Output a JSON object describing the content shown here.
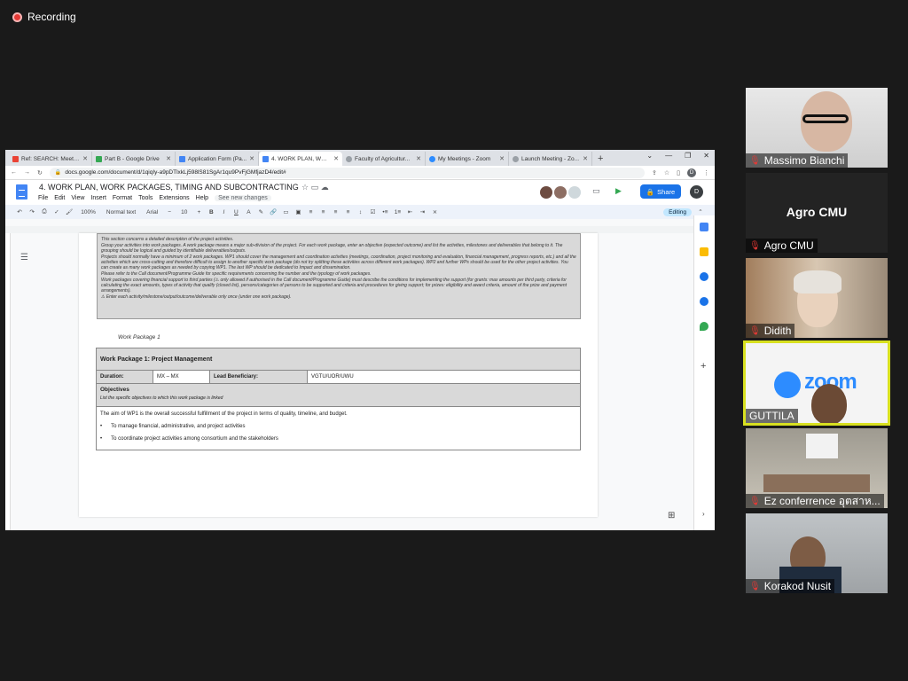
{
  "recording": {
    "label": "Recording"
  },
  "browser": {
    "tabs": [
      {
        "label": "Ref: SEARCH: Meetin...",
        "color": "#ea4335",
        "active": false
      },
      {
        "label": "Part B - Google Drive",
        "color": "#34a853",
        "active": false
      },
      {
        "label": "Application Form (Pa...",
        "color": "#4285f4",
        "active": false
      },
      {
        "label": "4. WORK PLAN, WOR...",
        "color": "#4285f4",
        "active": true
      },
      {
        "label": "Faculty of Agricultur...",
        "color": "#5f6368",
        "active": false
      },
      {
        "label": "My Meetings - Zoom",
        "color": "#2d8cff",
        "active": false
      },
      {
        "label": "Launch Meeting - Zo...",
        "color": "#5f6368",
        "active": false
      }
    ],
    "url": "docs.google.com/document/d/1qiqIy-a9pDTlxkLj598lS81SgAr1qu9PvFjGMfjazD4/edit#",
    "profile_initial": "D"
  },
  "docs": {
    "title": "4. WORK PLAN, WORK PACKAGES, TIMING AND SUBCONTRACTING",
    "menus": [
      "File",
      "Edit",
      "View",
      "Insert",
      "Format",
      "Tools",
      "Extensions",
      "Help"
    ],
    "see_changes": "See new changes",
    "share_label": "Share",
    "user_initial": "D",
    "toolbar": {
      "zoom": "100%",
      "style": "Normal text",
      "font": "Arial",
      "size": "10",
      "mode": "Editing"
    }
  },
  "document": {
    "guide": [
      "This section concerns a detailed description of the project activities.",
      "Group your activities into work packages. A work package means a major sub-division of the project. For each work package, enter an objective (expected outcome) and list the activities, milestones and deliverables that belong to it. The grouping should be logical and guided by identifiable deliverables/outputs.",
      "Projects should normally have a minimum of 2 work packages. WP1 should cover the management and coordination activities (meetings, coordination, project monitoring and evaluation, financial management, progress reports, etc.) and all the activities which are cross-cutting and therefore difficult to assign to another specific work package (do not try splitting these activities across different work packages). WP2 and further WPs should be used for the other project activities. You can create as many work packages as needed by copying WP1. The last WP should be dedicated to Impact and dissemination.",
      "Please refer to the Call document/Programme Guide for specific requirements concerning the number and the typology of work packages.",
      "Work packages covering financial support to third parties (⚠ only allowed if authorised in the Call document/Programme Guide) must describe the conditions for implementing the support (for grants: max amounts per third party, criteria for calculating the exact amounts, types of activity that qualify (closed list), persons/categories of persons to be supported and criteria and procedures for giving support; for prizes: eligibility and award criteria, amount of the prize and payment arrangements).",
      "⚠ Enter each activity/milestone/output/outcome/deliverable only once (under one work package)."
    ],
    "wp_label": "Work Package 1",
    "wp_title": "Work Package 1:  Project Management",
    "duration_label": "Duration:",
    "duration_value": "MX – MX",
    "lead_label": "Lead Beneficiary:",
    "lead_value": "VGTU/UOR/UWU",
    "objectives_title": "Objectives",
    "objectives_hint": "List the specific objectives to which this work package is linked",
    "aim": "The aim of WP1 is the overall successful fulfillment of the project in terms of quality, timeline, and budget.",
    "bullets": [
      "To manage financial, administrative, and project activities",
      "To coordinate project activities among consortium and the stakeholders"
    ]
  },
  "participants": [
    {
      "name": "Massimo Bianchi",
      "muted": true
    },
    {
      "name": "Agro CMU",
      "muted": true,
      "display": "Agro CMU"
    },
    {
      "name": "Didith",
      "muted": true
    },
    {
      "name": "GUTTILA",
      "muted": false,
      "active": true
    },
    {
      "name": "Ez conferrence อุตสาห...",
      "muted": true
    },
    {
      "name": "Korakod Nusit",
      "muted": true
    }
  ]
}
